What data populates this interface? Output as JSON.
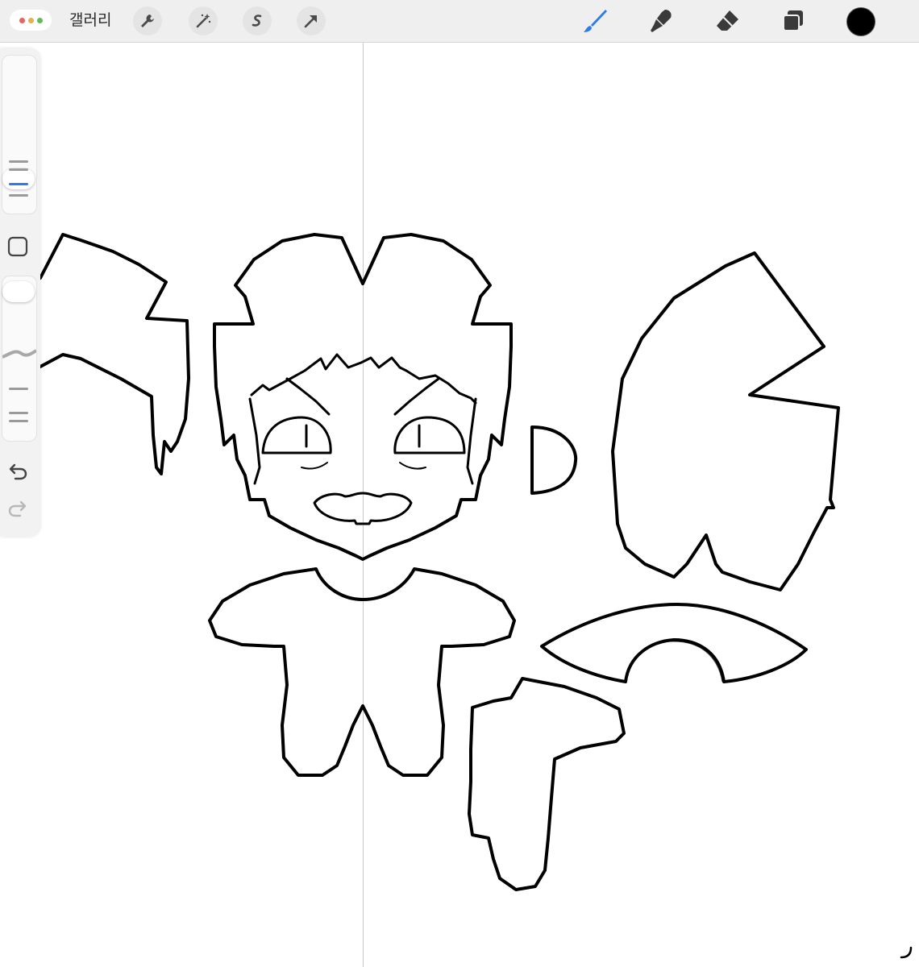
{
  "toolbar": {
    "gallery_label": "갤러리",
    "actions": [
      "wrench-icon",
      "magic-wand-icon",
      "selection-s-icon",
      "transform-arrow-icon"
    ],
    "tools": [
      "brush-icon",
      "smudge-icon",
      "eraser-icon",
      "layers-icon"
    ],
    "active_tool": "brush-icon",
    "accent_color": "#2b7bf0",
    "current_color": "#000000"
  },
  "sidebar": {
    "size_slider": "brush-size-slider",
    "opacity_slider": "opacity-slider",
    "modify_button": "modify-square-icon",
    "undo": "undo-icon",
    "redo": "redo-icon"
  },
  "canvas": {
    "drawing_guide": "vertical-symmetry-guide",
    "pieces": [
      "left-hair-piece",
      "head-piece",
      "ear-piece",
      "back-hair-piece",
      "body-piece",
      "arm-piece",
      "hat-brim-piece"
    ]
  }
}
